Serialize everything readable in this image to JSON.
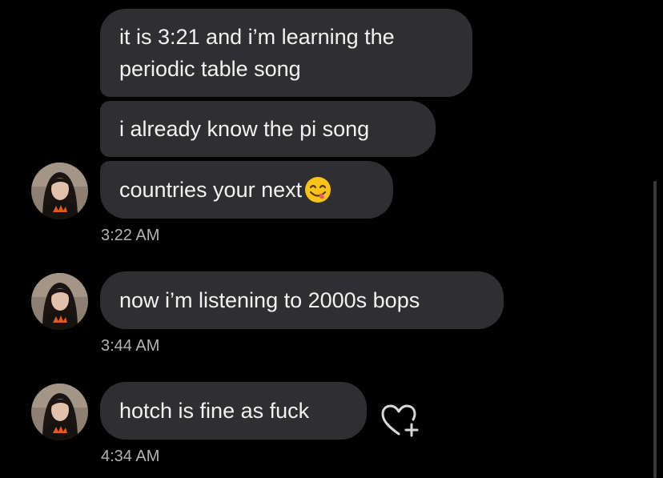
{
  "messages": [
    {
      "text": "it is 3:21 and i’m learning the periodic table song"
    },
    {
      "text": "i already know the pi song"
    },
    {
      "text": "countries your next",
      "emoji": "face-savoring-food-emoji"
    },
    {
      "text": "now i’m listening to 2000s bops"
    },
    {
      "text": "hotch is fine as fuck"
    }
  ],
  "timestamps": [
    "3:22 AM",
    "3:44 AM",
    "4:34 AM"
  ],
  "colors": {
    "background": "#000000",
    "bubble": "#2f2f31",
    "bubble_text": "#f2f2f2",
    "timestamp": "#b3b3b3",
    "heart_icon": "#d9d9d9"
  },
  "icons": {
    "react": "heart-plus-icon",
    "avatar": "sender-avatar"
  }
}
